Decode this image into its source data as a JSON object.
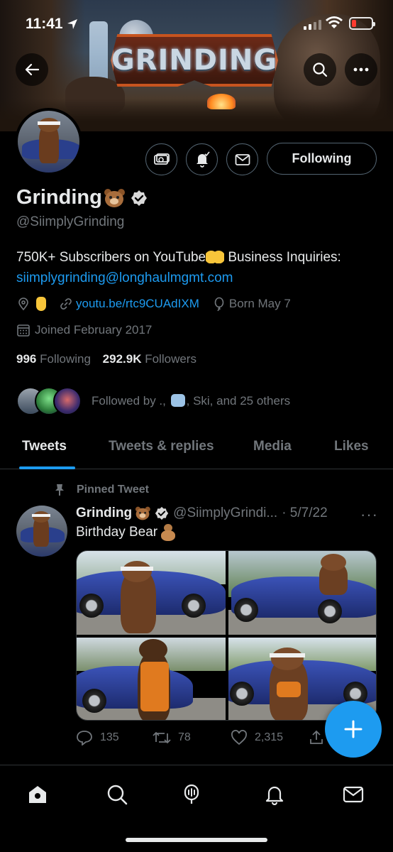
{
  "status_bar": {
    "time": "11:41"
  },
  "banner": {
    "logo_text": "GRINDING"
  },
  "profile": {
    "name": "Grinding",
    "handle": "@SiimplyGrinding",
    "bio_text": "750K+ Subscribers on YouTube",
    "bio_text2": " Business Inquiries: ",
    "bio_email": "siimplygrinding@longhaulmgmt.com",
    "website": "youtu.be/rtc9CUAdIXM",
    "birthday": "Born May 7",
    "joined": "Joined February 2017",
    "following_count": "996",
    "following_label": "Following",
    "followers_count": "292.9K",
    "followers_label": "Followers",
    "followed_by_prefix": "Followed by .,",
    "followed_by_suffix": ", Ski, and 25 others",
    "follow_button": "Following"
  },
  "tabs": [
    {
      "label": "Tweets",
      "active": true
    },
    {
      "label": "Tweets & replies",
      "active": false
    },
    {
      "label": "Media",
      "active": false
    },
    {
      "label": "Likes",
      "active": false
    }
  ],
  "tweet": {
    "pinned_label": "Pinned Tweet",
    "author": "Grinding",
    "handle": "@SiimplyGrindi...",
    "date": "· 5/7/22",
    "text": "Birthday Bear",
    "replies": "135",
    "retweets": "78",
    "likes": "2,315"
  },
  "colors": {
    "accent": "#1d9bf0",
    "muted": "#71767b",
    "border": "#2f3336"
  }
}
